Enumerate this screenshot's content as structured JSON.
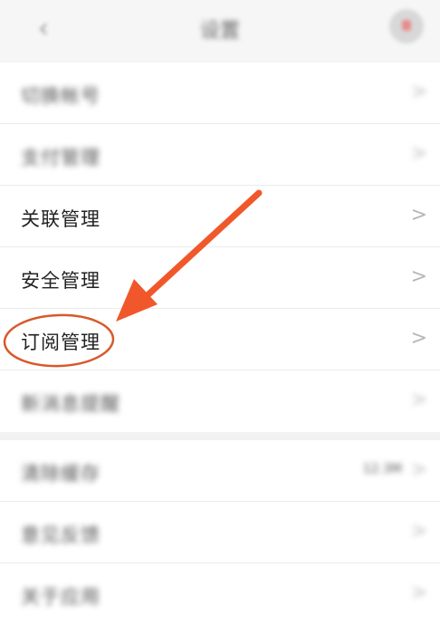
{
  "header": {
    "back_icon": "chevron-left-icon",
    "title": "设置",
    "avatar_icon": "avatar-icon"
  },
  "group1": {
    "items": [
      {
        "label": "切换帐号",
        "blurred": true
      },
      {
        "label": "支付管理",
        "blurred": true
      },
      {
        "label": "关联管理",
        "blurred": false
      },
      {
        "label": "安全管理",
        "blurred": false
      },
      {
        "label": "订阅管理",
        "blurred": false,
        "highlighted": true
      },
      {
        "label": "新消息提醒",
        "blurred": true
      }
    ]
  },
  "group2": {
    "items": [
      {
        "label": "清除缓存",
        "value": "12.3M",
        "blurred": true
      },
      {
        "label": "意见反馈",
        "blurred": true
      },
      {
        "label": "关于应用",
        "blurred": true
      }
    ]
  },
  "chevron_glyph": ">",
  "annotation": {
    "arrow_color": "#f0582c",
    "circle_color": "#d8582a"
  }
}
